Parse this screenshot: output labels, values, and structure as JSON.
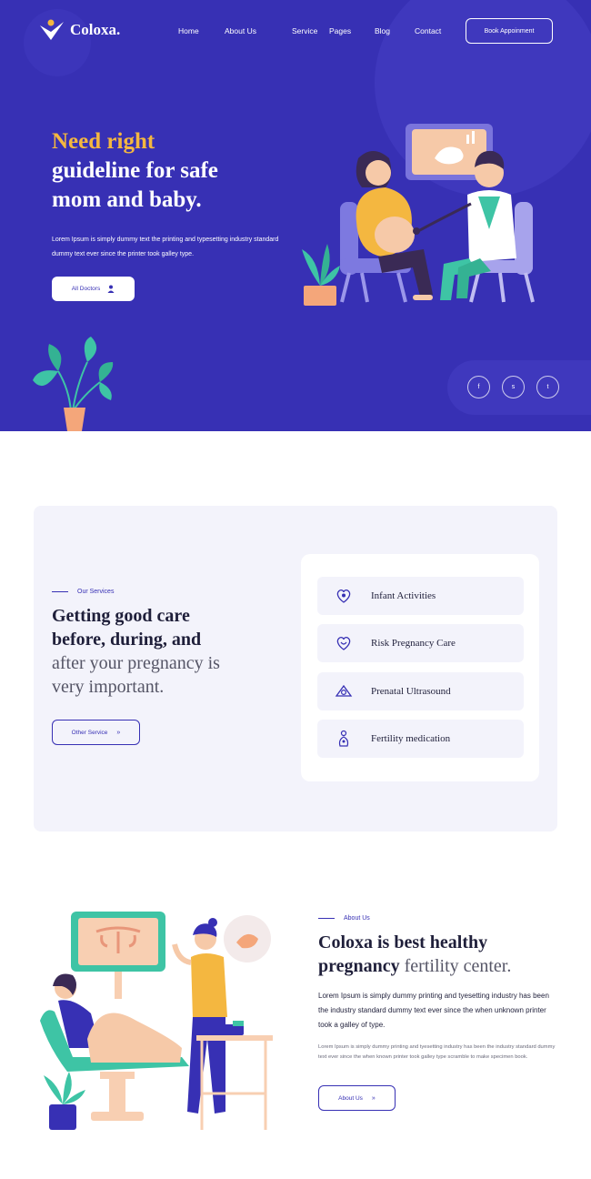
{
  "brand": {
    "name": "Coloxa."
  },
  "nav": {
    "items": [
      "Home",
      "About Us",
      "Service",
      "Pages",
      "Blog",
      "Contact"
    ]
  },
  "header": {
    "cta_label": "Book Appoinment"
  },
  "hero": {
    "title_line1": "Need right",
    "title_line2": "guideline for safe",
    "title_line3": "mom and baby.",
    "description": "Lorem Ipsum is simply dummy text the printing and typesetting industry standard dummy text ever since the printer took galley type.",
    "button_label": "All Doctors"
  },
  "social": {
    "icons": [
      "facebook-icon",
      "skype-icon",
      "twitter-icon"
    ],
    "glyphs": [
      "f",
      "s",
      "t"
    ]
  },
  "services": {
    "eyebrow": "Our Services",
    "title_bold_1": "Getting good care",
    "title_bold_2": "before, during, and",
    "title_light_1": "after your pregnancy is",
    "title_light_2": "very important.",
    "button_label": "Other Service",
    "items": [
      {
        "label": "Infant Activities",
        "icon": "infant-icon"
      },
      {
        "label": "Risk Pregnancy Care",
        "icon": "pregnancy-care-icon"
      },
      {
        "label": "Prenatal Ultrasound",
        "icon": "ultrasound-icon"
      },
      {
        "label": "Fertility medication",
        "icon": "fertility-icon"
      }
    ]
  },
  "about": {
    "eyebrow": "About Us",
    "title_bold_1": "Coloxa is best healthy",
    "title_bold_2": "pregnancy",
    "title_light_2": "fertility center.",
    "lead": "Lorem Ipsum is simply dummy printing and tyesetting industry has been the industry standard dummy text ever since the when unknown printer took a galley of type.",
    "body": "Lorem Ipsum is simply dummy printing and tyesetting industry has been the industry standard dummy text ever since the when known printer took galley type scramble to make specimen book.",
    "button_label": "About Us"
  },
  "colors": {
    "primary": "#3730b4",
    "accent": "#f4b740",
    "panel": "#f3f3fb",
    "teal": "#3ec4a5"
  }
}
